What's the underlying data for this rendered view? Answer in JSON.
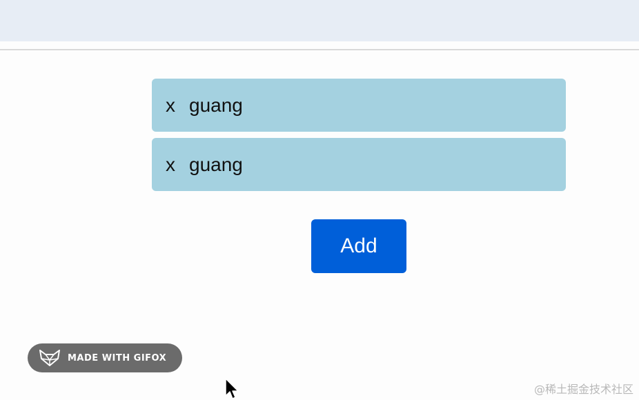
{
  "items": [
    {
      "remove_label": "x",
      "text": "guang"
    },
    {
      "remove_label": "x",
      "text": "guang"
    }
  ],
  "add_button_label": "Add",
  "badge": {
    "text": "MADE WITH GIFOX",
    "icon": "fox-icon"
  },
  "watermark": "@稀土掘金技术社区",
  "colors": {
    "item_bg": "#a4d1e0",
    "button_bg": "#005fd9",
    "topbar_bg": "#e7edf5"
  }
}
